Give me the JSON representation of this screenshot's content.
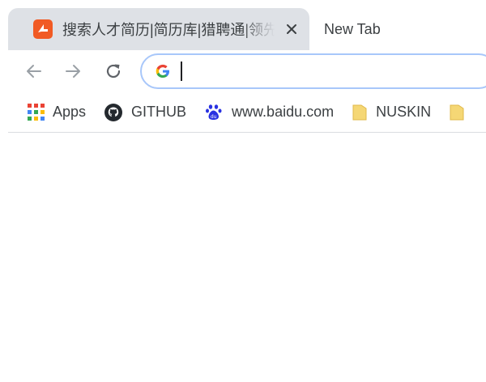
{
  "tabs": [
    {
      "title": "搜索人才简历|简历库|猎聘通|领先",
      "favicon": "liepin-favicon",
      "active": true
    },
    {
      "title": "New Tab",
      "active": false
    }
  ],
  "toolbar": {
    "back_icon": "back-arrow-icon",
    "forward_icon": "forward-arrow-icon",
    "reload_icon": "reload-icon"
  },
  "omnibox": {
    "value": "",
    "placeholder": "",
    "engine_icon": "google-g-icon"
  },
  "bookmarks": [
    {
      "label": "Apps",
      "icon": "apps-grid-icon"
    },
    {
      "label": "GITHUB",
      "icon": "github-icon"
    },
    {
      "label": "www.baidu.com",
      "icon": "baidu-paw-icon"
    },
    {
      "label": "NUSKIN",
      "icon": "folder-icon"
    }
  ],
  "colors": {
    "tab_active_bg": "#dee1e6",
    "omnibox_border": "#a8c7fa",
    "favicon_orange": "#f15a24",
    "baidu_blue": "#2932e1",
    "folder_yellow": "#f5d775"
  }
}
